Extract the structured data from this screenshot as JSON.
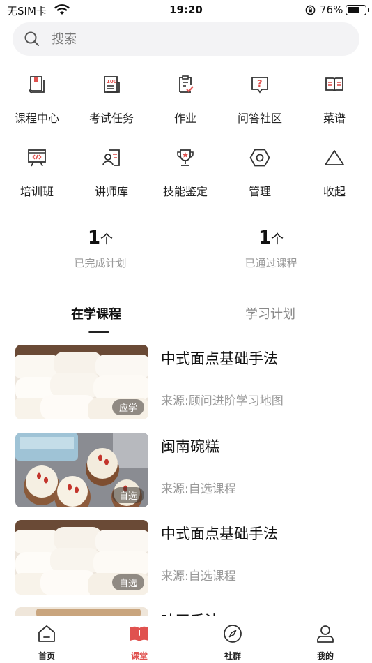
{
  "status_bar": {
    "carrier": "无SIM卡",
    "time": "19:20",
    "battery": "76%",
    "battery_level": 0.76
  },
  "search": {
    "placeholder": "搜索"
  },
  "grid": {
    "items": [
      {
        "label": "课程中心",
        "icon": "course-center-icon"
      },
      {
        "label": "考试任务",
        "icon": "exam-task-icon"
      },
      {
        "label": "作业",
        "icon": "homework-icon"
      },
      {
        "label": "问答社区",
        "icon": "qa-community-icon"
      },
      {
        "label": "菜谱",
        "icon": "recipe-book-icon"
      },
      {
        "label": "培训班",
        "icon": "training-class-icon"
      },
      {
        "label": "讲师库",
        "icon": "lecturer-icon"
      },
      {
        "label": "技能鉴定",
        "icon": "trophy-icon"
      },
      {
        "label": "管理",
        "icon": "hexagon-settings-icon"
      },
      {
        "label": "收起",
        "icon": "triangle-collapse-icon"
      }
    ]
  },
  "stats": [
    {
      "value": "1",
      "unit": "个",
      "label": "已完成计划"
    },
    {
      "value": "1",
      "unit": "个",
      "label": "已通过课程"
    }
  ],
  "tabs": [
    {
      "label": "在学课程",
      "active": true
    },
    {
      "label": "学习计划",
      "active": false
    }
  ],
  "courses": [
    {
      "title": "中式面点基础手法",
      "source": "来源:顾问进阶学习地图",
      "badge": "应学",
      "image": "steamed-buns"
    },
    {
      "title": "闽南碗糕",
      "source": "来源:自选课程",
      "badge": "自选",
      "image": "bowl-cakes"
    },
    {
      "title": "中式面点基础手法",
      "source": "来源:自选课程",
      "badge": "自选",
      "image": "steamed-buns"
    },
    {
      "title": "吐司手法",
      "source": "",
      "badge": "",
      "image": "toast"
    }
  ],
  "bottom_nav": [
    {
      "label": "首页",
      "icon": "home-icon",
      "active": false
    },
    {
      "label": "课堂",
      "icon": "classroom-book-icon",
      "active": true
    },
    {
      "label": "社群",
      "icon": "compass-icon",
      "active": false
    },
    {
      "label": "我的",
      "icon": "user-icon",
      "active": false
    }
  ],
  "colors": {
    "accent": "#e0524f",
    "icon_stroke": "#333333",
    "icon_accent": "#e0524f"
  }
}
